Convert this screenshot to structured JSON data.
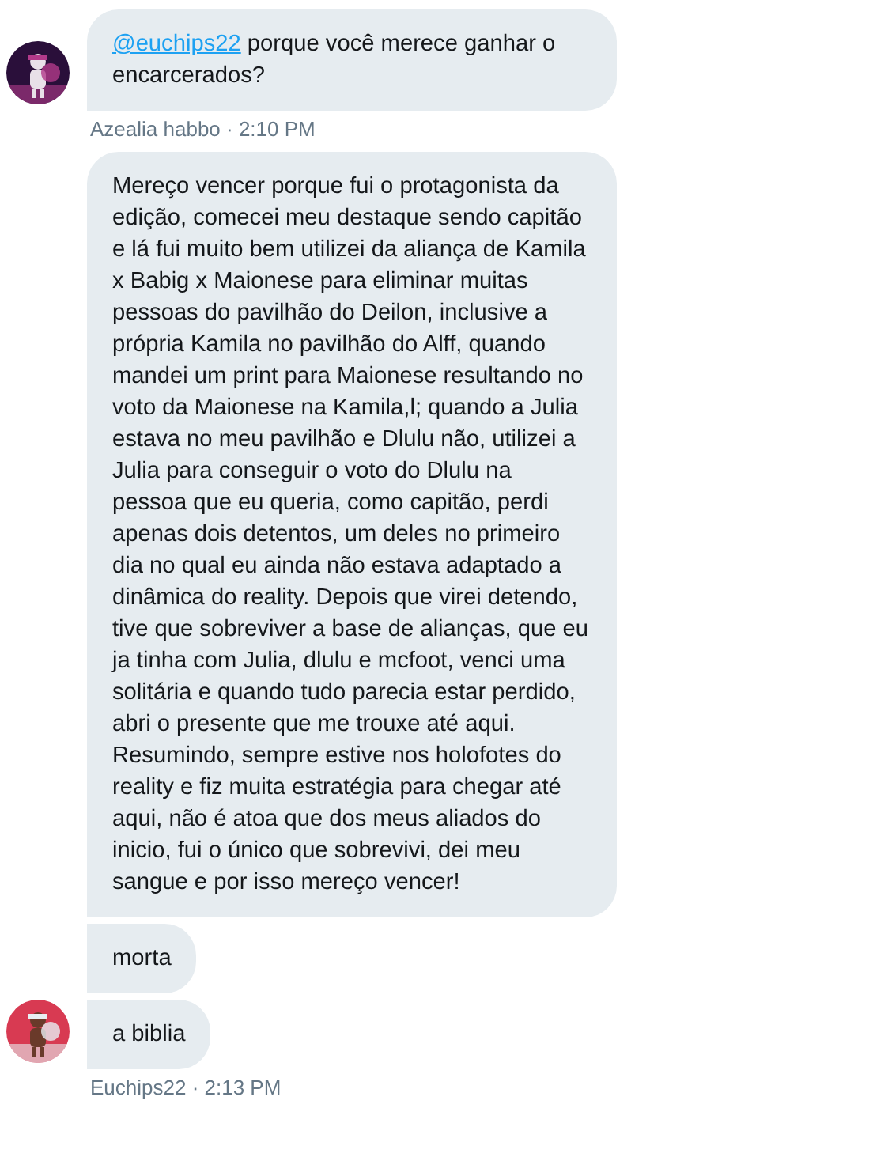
{
  "groups": [
    {
      "avatar": {
        "kind": "picture"
      },
      "messages": [
        {
          "mention": "@euchips22",
          "text": "porque você merece ganhar o encarcerados?"
        }
      ],
      "meta": "Azealia habbo · 2:10 PM"
    },
    {
      "avatar": {
        "kind": "picture"
      },
      "messages": [
        {
          "text": "Mereço vencer porque fui o protagonista da edição, comecei meu destaque sendo capitão e lá fui muito bem utilizei da aliança de Kamila x Babig x Maionese para eliminar muitas pessoas do pavilhão do Deilon, inclusive a própria Kamila no pavilhão do Alff, quando mandei um print para Maionese resultando no voto da Maionese na Kamila,l; quando a Julia estava no meu pavilhão e Dlulu não, utilizei a Julia para conseguir o voto do Dlulu na pessoa que eu queria, como capitão, perdi apenas dois detentos, um deles no primeiro dia no qual eu ainda não estava adaptado a dinâmica do reality. Depois que virei detendo, tive que sobreviver a base de alianças, que eu ja tinha com Julia, dlulu e mcfoot, venci uma solitária e quando tudo parecia estar perdido, abri o presente que me trouxe até aqui. Resumindo, sempre estive nos holofotes do reality e fiz muita estratégia para chegar até aqui, não é atoa que dos meus aliados do inicio, fui o único que sobrevivi, dei meu sangue e por isso mereço vencer!"
        },
        {
          "text": "morta"
        },
        {
          "text": "a biblia"
        }
      ],
      "meta": "Euchips22 · 2:13 PM"
    }
  ]
}
